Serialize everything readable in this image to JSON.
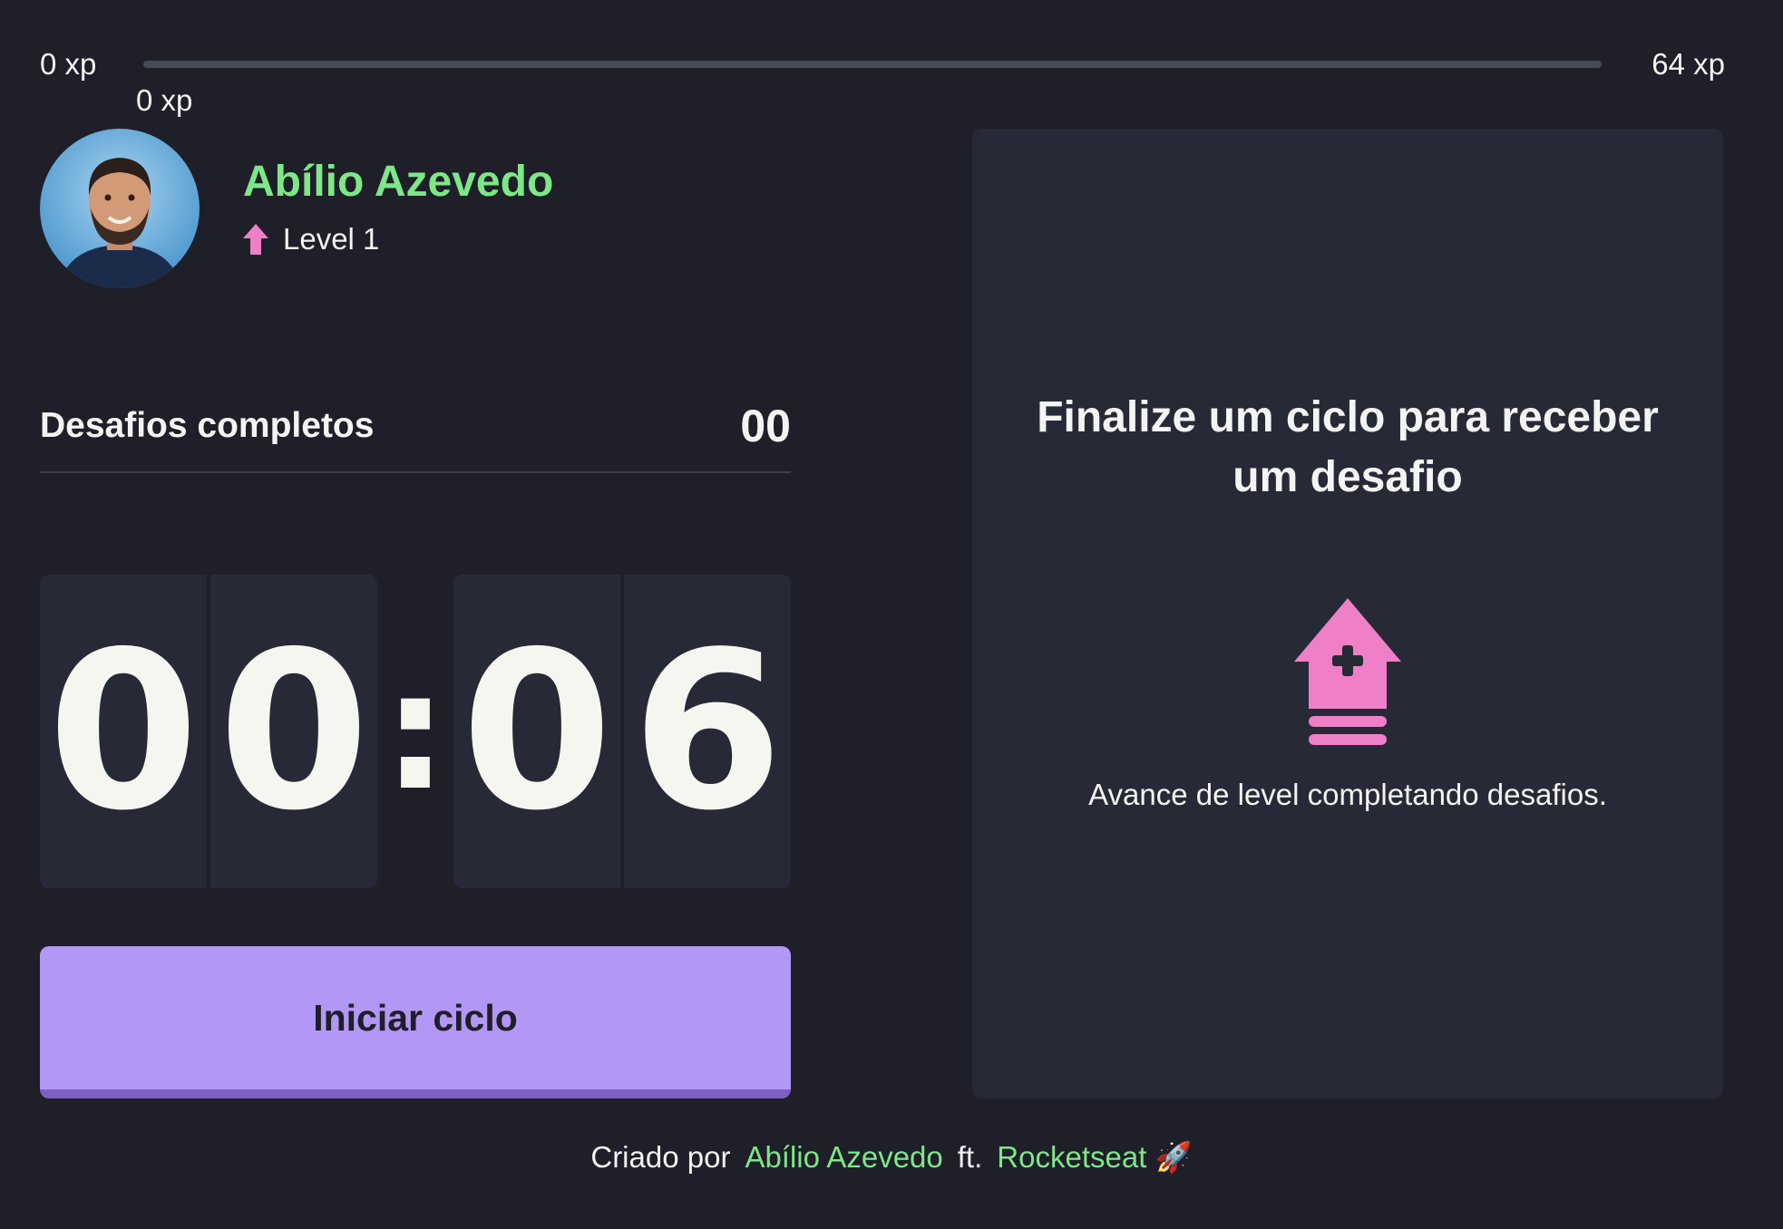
{
  "xp": {
    "min_label": "0 xp",
    "max_label": "64 xp",
    "current_label": "0 xp",
    "progress_percent": 0
  },
  "profile": {
    "name": "Abílio Azevedo",
    "level_label": "Level 1",
    "level_icon": "level-up-arrow-icon"
  },
  "challenges": {
    "label": "Desafios completos",
    "count": "00"
  },
  "countdown": {
    "minute_left": "0",
    "minute_right": "0",
    "separator": ":",
    "second_left": "0",
    "second_right": "6"
  },
  "actions": {
    "start_label": "Iniciar ciclo"
  },
  "challenge_panel": {
    "title": "Finalize um ciclo para receber um desafio",
    "hint": "Avance de level completando desafios.",
    "icon": "level-up-icon"
  },
  "footer": {
    "created_by": "Criado por",
    "author": "Abílio Azevedo",
    "ft": "ft.",
    "org": "Rocketseat 🚀"
  },
  "colors": {
    "background": "#1e1f29",
    "panel": "#272a36",
    "accent_green": "#7ee787",
    "button_purple": "#b397f4",
    "icon_pink": "#ef7fc6"
  }
}
